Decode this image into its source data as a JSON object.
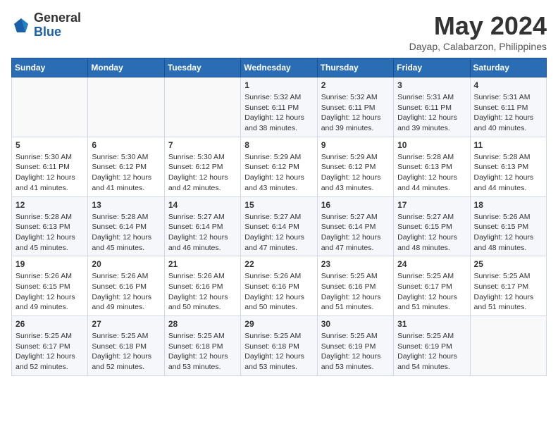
{
  "logo": {
    "general": "General",
    "blue": "Blue"
  },
  "title": "May 2024",
  "location": "Dayap, Calabarzon, Philippines",
  "weekdays": [
    "Sunday",
    "Monday",
    "Tuesday",
    "Wednesday",
    "Thursday",
    "Friday",
    "Saturday"
  ],
  "weeks": [
    [
      {
        "day": "",
        "sunrise": "",
        "sunset": "",
        "daylight": ""
      },
      {
        "day": "",
        "sunrise": "",
        "sunset": "",
        "daylight": ""
      },
      {
        "day": "",
        "sunrise": "",
        "sunset": "",
        "daylight": ""
      },
      {
        "day": "1",
        "sunrise": "Sunrise: 5:32 AM",
        "sunset": "Sunset: 6:11 PM",
        "daylight": "Daylight: 12 hours and 38 minutes."
      },
      {
        "day": "2",
        "sunrise": "Sunrise: 5:32 AM",
        "sunset": "Sunset: 6:11 PM",
        "daylight": "Daylight: 12 hours and 39 minutes."
      },
      {
        "day": "3",
        "sunrise": "Sunrise: 5:31 AM",
        "sunset": "Sunset: 6:11 PM",
        "daylight": "Daylight: 12 hours and 39 minutes."
      },
      {
        "day": "4",
        "sunrise": "Sunrise: 5:31 AM",
        "sunset": "Sunset: 6:11 PM",
        "daylight": "Daylight: 12 hours and 40 minutes."
      }
    ],
    [
      {
        "day": "5",
        "sunrise": "Sunrise: 5:30 AM",
        "sunset": "Sunset: 6:11 PM",
        "daylight": "Daylight: 12 hours and 41 minutes."
      },
      {
        "day": "6",
        "sunrise": "Sunrise: 5:30 AM",
        "sunset": "Sunset: 6:12 PM",
        "daylight": "Daylight: 12 hours and 41 minutes."
      },
      {
        "day": "7",
        "sunrise": "Sunrise: 5:30 AM",
        "sunset": "Sunset: 6:12 PM",
        "daylight": "Daylight: 12 hours and 42 minutes."
      },
      {
        "day": "8",
        "sunrise": "Sunrise: 5:29 AM",
        "sunset": "Sunset: 6:12 PM",
        "daylight": "Daylight: 12 hours and 43 minutes."
      },
      {
        "day": "9",
        "sunrise": "Sunrise: 5:29 AM",
        "sunset": "Sunset: 6:12 PM",
        "daylight": "Daylight: 12 hours and 43 minutes."
      },
      {
        "day": "10",
        "sunrise": "Sunrise: 5:28 AM",
        "sunset": "Sunset: 6:13 PM",
        "daylight": "Daylight: 12 hours and 44 minutes."
      },
      {
        "day": "11",
        "sunrise": "Sunrise: 5:28 AM",
        "sunset": "Sunset: 6:13 PM",
        "daylight": "Daylight: 12 hours and 44 minutes."
      }
    ],
    [
      {
        "day": "12",
        "sunrise": "Sunrise: 5:28 AM",
        "sunset": "Sunset: 6:13 PM",
        "daylight": "Daylight: 12 hours and 45 minutes."
      },
      {
        "day": "13",
        "sunrise": "Sunrise: 5:28 AM",
        "sunset": "Sunset: 6:14 PM",
        "daylight": "Daylight: 12 hours and 45 minutes."
      },
      {
        "day": "14",
        "sunrise": "Sunrise: 5:27 AM",
        "sunset": "Sunset: 6:14 PM",
        "daylight": "Daylight: 12 hours and 46 minutes."
      },
      {
        "day": "15",
        "sunrise": "Sunrise: 5:27 AM",
        "sunset": "Sunset: 6:14 PM",
        "daylight": "Daylight: 12 hours and 47 minutes."
      },
      {
        "day": "16",
        "sunrise": "Sunrise: 5:27 AM",
        "sunset": "Sunset: 6:14 PM",
        "daylight": "Daylight: 12 hours and 47 minutes."
      },
      {
        "day": "17",
        "sunrise": "Sunrise: 5:27 AM",
        "sunset": "Sunset: 6:15 PM",
        "daylight": "Daylight: 12 hours and 48 minutes."
      },
      {
        "day": "18",
        "sunrise": "Sunrise: 5:26 AM",
        "sunset": "Sunset: 6:15 PM",
        "daylight": "Daylight: 12 hours and 48 minutes."
      }
    ],
    [
      {
        "day": "19",
        "sunrise": "Sunrise: 5:26 AM",
        "sunset": "Sunset: 6:15 PM",
        "daylight": "Daylight: 12 hours and 49 minutes."
      },
      {
        "day": "20",
        "sunrise": "Sunrise: 5:26 AM",
        "sunset": "Sunset: 6:16 PM",
        "daylight": "Daylight: 12 hours and 49 minutes."
      },
      {
        "day": "21",
        "sunrise": "Sunrise: 5:26 AM",
        "sunset": "Sunset: 6:16 PM",
        "daylight": "Daylight: 12 hours and 50 minutes."
      },
      {
        "day": "22",
        "sunrise": "Sunrise: 5:26 AM",
        "sunset": "Sunset: 6:16 PM",
        "daylight": "Daylight: 12 hours and 50 minutes."
      },
      {
        "day": "23",
        "sunrise": "Sunrise: 5:25 AM",
        "sunset": "Sunset: 6:16 PM",
        "daylight": "Daylight: 12 hours and 51 minutes."
      },
      {
        "day": "24",
        "sunrise": "Sunrise: 5:25 AM",
        "sunset": "Sunset: 6:17 PM",
        "daylight": "Daylight: 12 hours and 51 minutes."
      },
      {
        "day": "25",
        "sunrise": "Sunrise: 5:25 AM",
        "sunset": "Sunset: 6:17 PM",
        "daylight": "Daylight: 12 hours and 51 minutes."
      }
    ],
    [
      {
        "day": "26",
        "sunrise": "Sunrise: 5:25 AM",
        "sunset": "Sunset: 6:17 PM",
        "daylight": "Daylight: 12 hours and 52 minutes."
      },
      {
        "day": "27",
        "sunrise": "Sunrise: 5:25 AM",
        "sunset": "Sunset: 6:18 PM",
        "daylight": "Daylight: 12 hours and 52 minutes."
      },
      {
        "day": "28",
        "sunrise": "Sunrise: 5:25 AM",
        "sunset": "Sunset: 6:18 PM",
        "daylight": "Daylight: 12 hours and 53 minutes."
      },
      {
        "day": "29",
        "sunrise": "Sunrise: 5:25 AM",
        "sunset": "Sunset: 6:18 PM",
        "daylight": "Daylight: 12 hours and 53 minutes."
      },
      {
        "day": "30",
        "sunrise": "Sunrise: 5:25 AM",
        "sunset": "Sunset: 6:19 PM",
        "daylight": "Daylight: 12 hours and 53 minutes."
      },
      {
        "day": "31",
        "sunrise": "Sunrise: 5:25 AM",
        "sunset": "Sunset: 6:19 PM",
        "daylight": "Daylight: 12 hours and 54 minutes."
      },
      {
        "day": "",
        "sunrise": "",
        "sunset": "",
        "daylight": ""
      }
    ]
  ]
}
